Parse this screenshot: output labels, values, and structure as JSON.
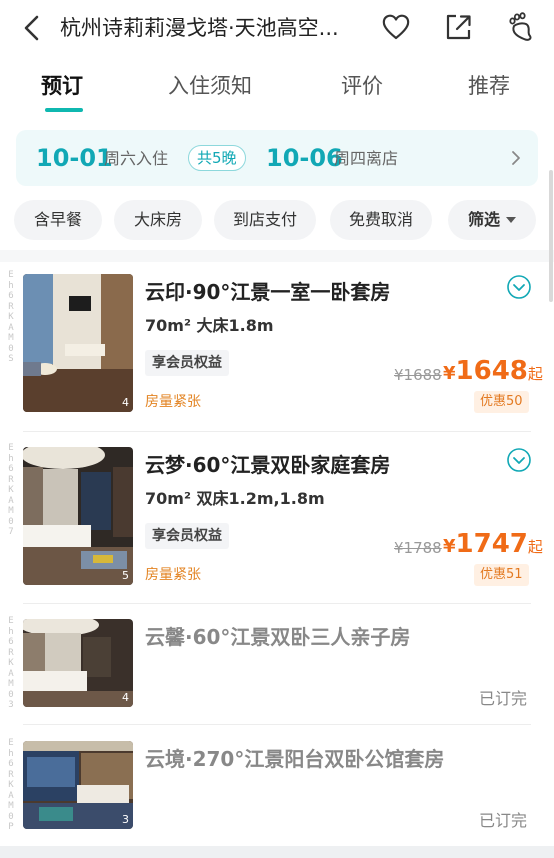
{
  "header": {
    "title": "杭州诗莉莉漫戈塔·天池高空..."
  },
  "tabs": [
    {
      "label": "预订"
    },
    {
      "label": "入住须知"
    },
    {
      "label": "评价"
    },
    {
      "label": "推荐"
    }
  ],
  "dates": {
    "checkin_date": "10-01",
    "checkin_label": "周六入住",
    "nights": "共5晚",
    "checkout_date": "10-06",
    "checkout_label": "周四离店"
  },
  "filters": [
    {
      "label": "含早餐"
    },
    {
      "label": "大床房"
    },
    {
      "label": "到店支付"
    },
    {
      "label": "免费取消"
    },
    {
      "label": "筛选"
    }
  ],
  "rooms": [
    {
      "code": "Eh6RKAM0S",
      "name": "云印·90°江景一室一卧套房",
      "spec": "70m²  大床1.8m",
      "member_tag": "享会员权益",
      "scarce": "房量紧张",
      "photo_count": "4",
      "old_price": "¥1688",
      "currency": "¥",
      "price": "1648",
      "price_suffix": "起",
      "discount": "优惠50"
    },
    {
      "code": "Eh6RKAM07",
      "name": "云梦·60°江景双卧家庭套房",
      "spec": "70m²  双床1.2m,1.8m",
      "member_tag": "享会员权益",
      "scarce": "房量紧张",
      "photo_count": "5",
      "old_price": "¥1788",
      "currency": "¥",
      "price": "1747",
      "price_suffix": "起",
      "discount": "优惠51"
    },
    {
      "code": "Eh6RKAM03",
      "name": "云馨·60°江景双卧三人亲子房",
      "photo_count": "4",
      "status": "已订完"
    },
    {
      "code": "Eh6RKAM0P",
      "name": "云境·270°江景阳台双卧公馆套房",
      "photo_count": "3",
      "status": "已订完"
    }
  ],
  "colors": {
    "accent": "#11a8b5",
    "price": "#f06b17",
    "warning": "#e38525"
  }
}
